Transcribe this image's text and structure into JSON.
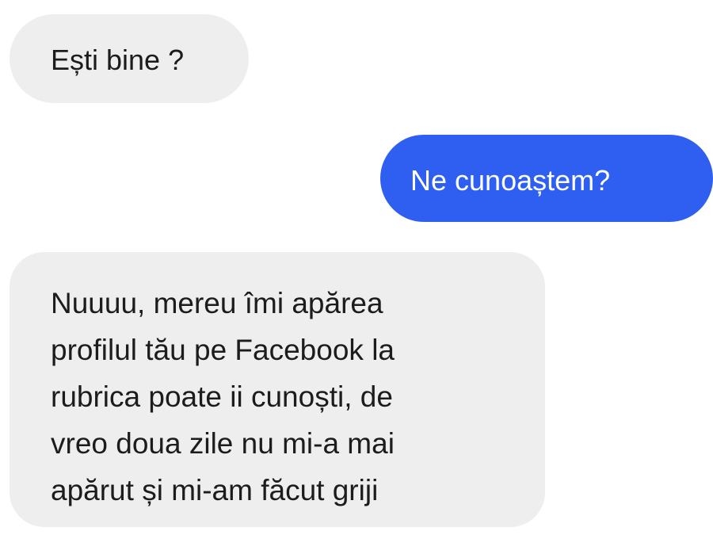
{
  "conversation": {
    "messages": [
      {
        "direction": "incoming",
        "text": "Ești bine ?"
      },
      {
        "direction": "outgoing",
        "text": "Ne cunoaștem?"
      },
      {
        "direction": "incoming",
        "text": "Nuuuu, mereu îmi apărea\nprofilul tău pe Facebook la\nrubrica poate ii cunoști,  de\nvreo doua zile nu mi-a mai\napărut și mi-am făcut griji"
      }
    ]
  },
  "colors": {
    "incoming_bubble": "#eeeeee",
    "outgoing_bubble": "#2f5ff0",
    "incoming_text": "#1c1c1c",
    "outgoing_text": "#ffffff"
  }
}
